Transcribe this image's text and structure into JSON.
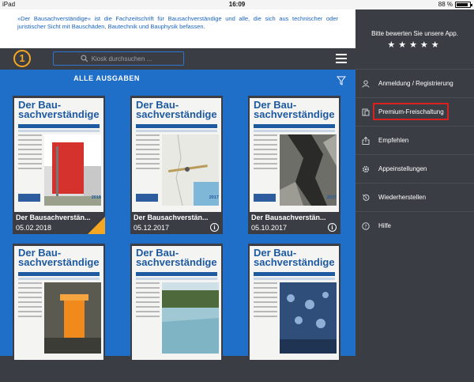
{
  "statusbar": {
    "device": "iPad",
    "time": "16:09",
    "battery_text": "88 %",
    "battery_level": 0.88
  },
  "description": "»Der Bausachverständige« ist die Fachzeitschrift für Bausachverständige und alle, die sich aus technischer oder juristischer Sicht mit Bauschäden, Bautechnik und Bauphysik befassen.",
  "topbar": {
    "logo_text": "1",
    "search_placeholder": "Kiosk durchsuchen ..."
  },
  "section_title": "ALLE AUSGABEN",
  "magazine_masthead": [
    "Der Bau-",
    "sachverständige"
  ],
  "issues": [
    {
      "title": "Der Bausachverstän...",
      "date": "05.02.2018",
      "year": "2018",
      "badge": "download-corner"
    },
    {
      "title": "Der Bausachverstän...",
      "date": "05.12.2017",
      "year": "2017",
      "badge": "info"
    },
    {
      "title": "Der Bausachverstän...",
      "date": "05.10.2017",
      "year": "2017",
      "badge": "info"
    },
    {
      "title": "",
      "date": "",
      "year": "",
      "badge": ""
    },
    {
      "title": "",
      "date": "",
      "year": "",
      "badge": ""
    },
    {
      "title": "",
      "date": "",
      "year": "",
      "badge": ""
    }
  ],
  "sidebar": {
    "rate_text": "Bitte bewerten Sie unsere App.",
    "stars": "★★★★★",
    "items": [
      {
        "label": "Anmeldung / Registrierung",
        "icon": "user-icon"
      },
      {
        "label": "Premium-Freischaltung",
        "icon": "premium-icon",
        "highlighted": true
      },
      {
        "label": "Empfehlen",
        "icon": "share-icon"
      },
      {
        "label": "Appeinstellungen",
        "icon": "gear-icon"
      },
      {
        "label": "Wiederherstellen",
        "icon": "restore-icon"
      },
      {
        "label": "Hilfe",
        "icon": "help-icon"
      }
    ]
  },
  "colors": {
    "accent": "#f5a623",
    "brand_blue": "#1f6ec8",
    "dark": "#3a3d43",
    "highlight_red": "#d9211f"
  }
}
